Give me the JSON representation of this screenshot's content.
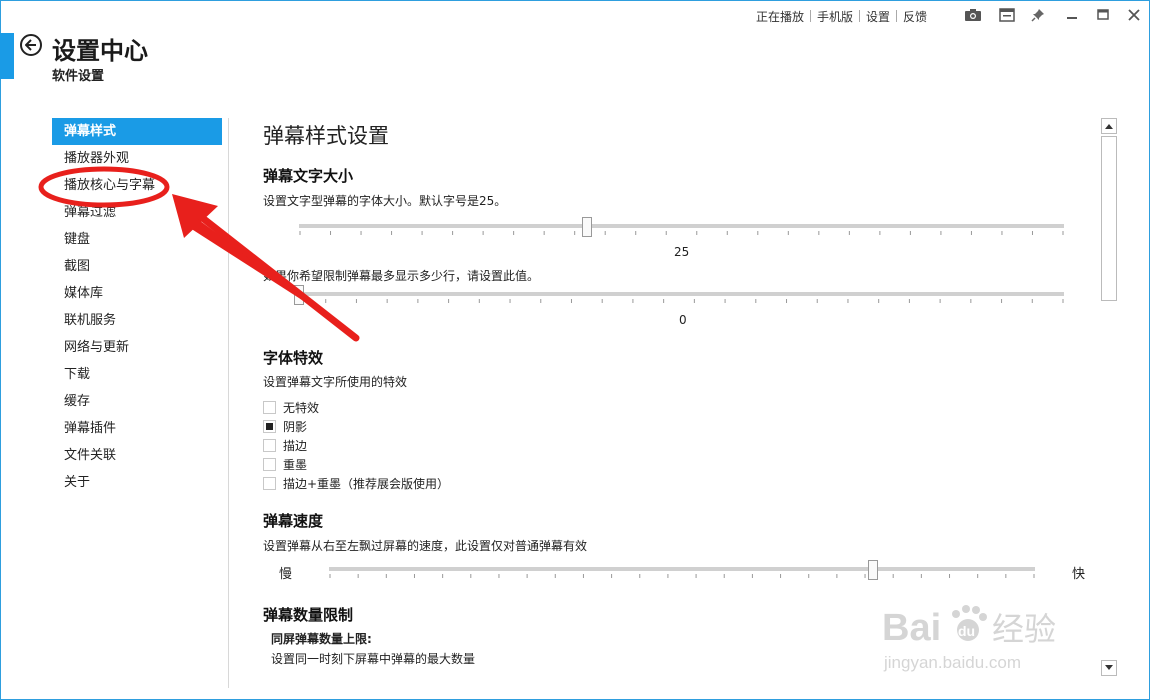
{
  "topnav": {
    "now_playing": "正在播放",
    "mobile": "手机版",
    "settings": "设置",
    "feedback": "反馈"
  },
  "header": {
    "title": "设置中心",
    "subtitle": "软件设置"
  },
  "sidebar": {
    "items": [
      {
        "label": "弹幕样式",
        "active": true
      },
      {
        "label": "播放器外观"
      },
      {
        "label": "播放核心与字幕"
      },
      {
        "label": "弹幕过滤"
      },
      {
        "label": "键盘"
      },
      {
        "label": "截图"
      },
      {
        "label": "媒体库"
      },
      {
        "label": "联机服务"
      },
      {
        "label": "网络与更新"
      },
      {
        "label": "下载"
      },
      {
        "label": "缓存"
      },
      {
        "label": "弹幕插件"
      },
      {
        "label": "文件关联"
      },
      {
        "label": "关于"
      }
    ]
  },
  "content": {
    "section_title": "弹幕样式设置",
    "font_size": {
      "heading": "弹幕文字大小",
      "desc": "设置文字型弹幕的字体大小。默认字号是25。",
      "value": "25",
      "fraction": 0.375
    },
    "max_lines": {
      "desc": "如果你希望限制弹幕最多显示多少行，请设置此值。",
      "value": "0",
      "fraction": 0.0
    },
    "font_effect": {
      "heading": "字体特效",
      "desc": "设置弹幕文字所使用的特效",
      "options": [
        {
          "label": "无特效",
          "checked": false
        },
        {
          "label": "阴影",
          "checked": true
        },
        {
          "label": "描边",
          "checked": false
        },
        {
          "label": "重墨",
          "checked": false
        },
        {
          "label": "描边+重墨（推荐展会版使用）",
          "checked": false
        }
      ]
    },
    "speed": {
      "heading": "弹幕速度",
      "desc": "设置弹幕从右至左飘过屏幕的速度，此设置仅对普通弹幕有效",
      "slow_label": "慢",
      "fast_label": "快",
      "fraction": 0.775
    },
    "count_limit": {
      "heading": "弹幕数量限制",
      "subheading": "同屏弹幕数量上限:",
      "desc": "设置同一时刻下屏幕中弹幕的最大数量"
    }
  },
  "watermark": {
    "line1": "Bai",
    "line1b": "du",
    "line1c": "经验",
    "line2": "jingyan.baidu.com"
  },
  "colors": {
    "accent": "#1a9be6",
    "annotation": "#e8201c"
  }
}
